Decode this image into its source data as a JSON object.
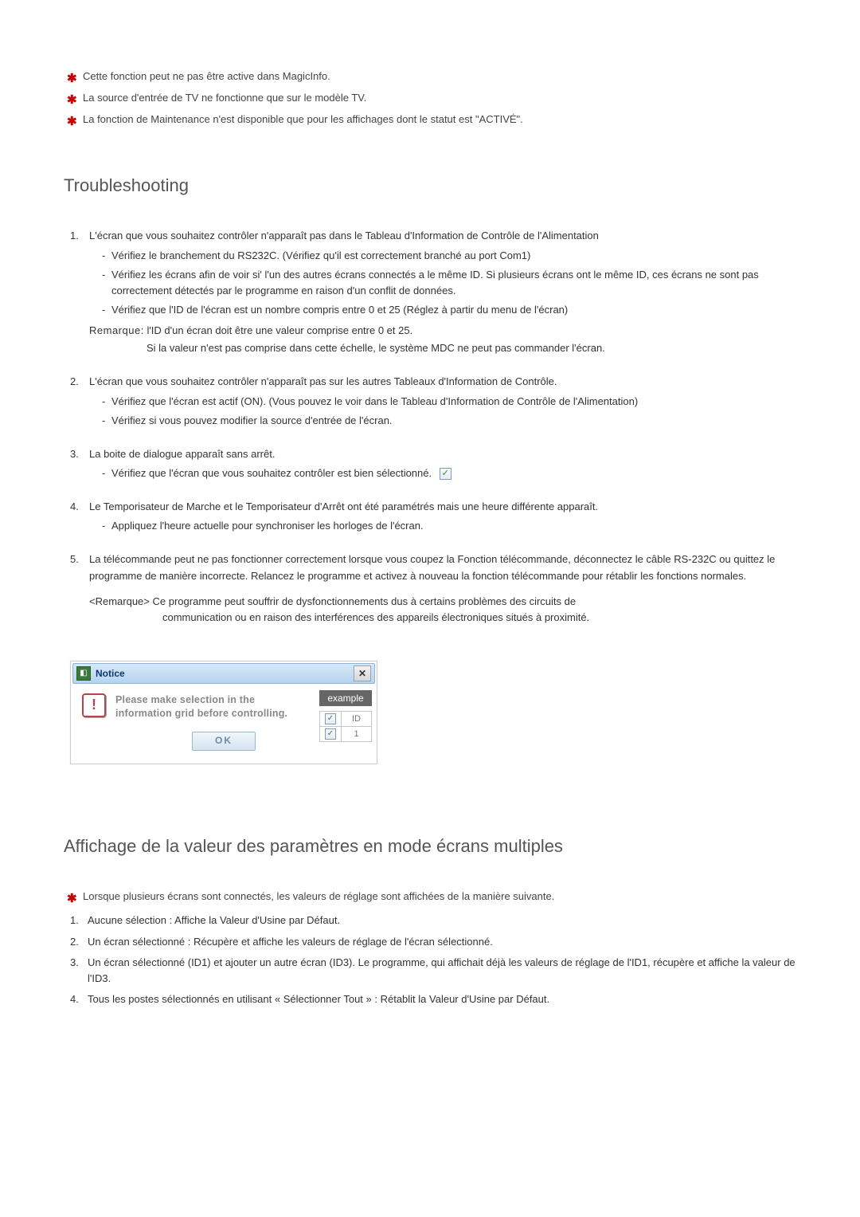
{
  "top_notes": [
    "Cette fonction peut ne pas être active dans MagicInfo.",
    "La source d'entrée de TV ne fonctionne que sur le modèle TV.",
    "La fonction de Maintenance n'est disponible que pour les affichages dont le statut est \"ACTIVÉ\"."
  ],
  "troubleshooting": {
    "heading": "Troubleshooting",
    "items": [
      {
        "num": "1.",
        "text": "L'écran que vous souhaitez contrôler n'apparaît pas dans le Tableau d'Information de Contrôle de l'Alimentation",
        "subs": [
          "Vérifiez le branchement du RS232C. (Vérifiez qu'il est correctement branché au port Com1)",
          "Vérifiez les écrans afin de voir si' l'un des autres écrans connectés a le même ID. Si plusieurs écrans ont le même ID, ces écrans ne sont pas correctement détectés par le programme en raison d'un conflit de données.",
          "Vérifiez que l'ID de l'écran est un nombre compris entre 0 et 25 (Réglez à partir du menu de l'écran)"
        ],
        "remarque_label": "Remarque:",
        "remarque_text": "l'ID d'un écran doit être une valeur comprise entre 0 et 25.",
        "remarque_cont": "Si la valeur n'est pas comprise dans cette échelle, le système MDC ne peut pas commander l'écran."
      },
      {
        "num": "2.",
        "text": "L'écran que vous souhaitez contrôler n'apparaît pas sur les autres Tableaux d'Information de Contrôle.",
        "subs": [
          "Vérifiez que l'écran est actif (ON). (Vous pouvez le voir dans le Tableau d'Information de Contrôle de l'Alimentation)",
          "Vérifiez si vous pouvez modifier la source d'entrée de l'écran."
        ]
      },
      {
        "num": "3.",
        "text": "La boite de dialogue apparaît sans arrêt.",
        "subs_with_check": "Vérifiez que l'écran que vous souhaitez contrôler est bien sélectionné."
      },
      {
        "num": "4.",
        "text": "Le Temporisateur de Marche et le Temporisateur d'Arrêt ont été paramétrés mais une heure différente apparaît.",
        "subs": [
          "Appliquez l'heure actuelle pour synchroniser les horloges de l'écran."
        ]
      },
      {
        "num": "5.",
        "text": "La télécommande peut ne pas fonctionner correctement lorsque vous coupez la Fonction télécommande, déconnectez le câble RS-232C ou quittez le programme de manière incorrecte. Relancez le programme et activez à nouveau la fonction télécommande pour rétablir les fonctions normales.",
        "remarque_block_label": "<Remarque>",
        "remarque_block_text": "Ce programme peut souffrir de dysfonctionnements dus à certains problèmes des circuits de",
        "remarque_block_cont": "communication ou en raison des interférences des appareils électroniques situés à proximité."
      }
    ]
  },
  "dialog": {
    "title": "Notice",
    "message_line1": "Please make selection in the",
    "message_line2": "information grid before controlling.",
    "ok": "OK",
    "example_label": "example",
    "table_header": "ID",
    "table_row1": "1"
  },
  "multiscreen": {
    "heading": "Affichage de la valeur des paramètres en mode écrans multiples",
    "star_note": "Lorsque plusieurs écrans sont connectés, les valeurs de réglage sont affichées de la manière suivante.",
    "items": [
      {
        "num": "1.",
        "text": "Aucune sélection : Affiche la Valeur d'Usine par Défaut."
      },
      {
        "num": "2.",
        "text": "Un écran sélectionné : Récupère et affiche les valeurs de réglage de l'écran sélectionné."
      },
      {
        "num": "3.",
        "text": "Un écran sélectionné (ID1) et ajouter un autre écran (ID3). Le programme, qui affichait déjà les valeurs de réglage de l'ID1, récupère et affiche la valeur de l'ID3."
      },
      {
        "num": "4.",
        "text": "Tous les postes sélectionnés en utilisant « Sélectionner Tout » : Rétablit la Valeur d'Usine par Défaut."
      }
    ]
  }
}
